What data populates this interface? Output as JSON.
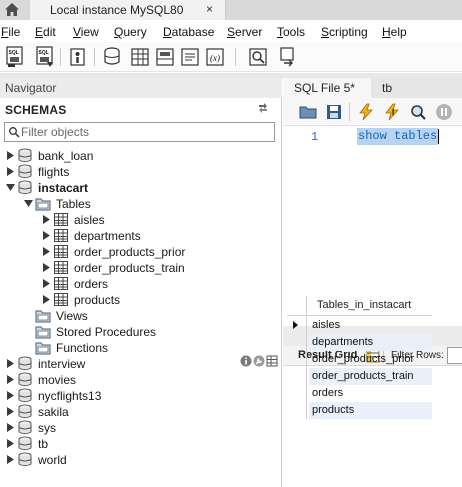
{
  "connection_tab": {
    "label": "Local instance MySQL80",
    "close": "×"
  },
  "menu": [
    {
      "label": "File",
      "acc": "F",
      "rest": "ile"
    },
    {
      "label": "Edit",
      "acc": "E",
      "rest": "dit"
    },
    {
      "label": "View",
      "acc": "V",
      "rest": "iew"
    },
    {
      "label": "Query",
      "acc": "Q",
      "rest": "uery"
    },
    {
      "label": "Database",
      "acc": "D",
      "rest": "atabase"
    },
    {
      "label": "Server",
      "acc": "S",
      "rest": "erver"
    },
    {
      "label": "Tools",
      "acc": "T",
      "rest": "ools"
    },
    {
      "label": "Scripting",
      "acc": "S",
      "rest": "cripting"
    },
    {
      "label": "Help",
      "acc": "H",
      "rest": "elp"
    }
  ],
  "navigator": {
    "header": "Navigator",
    "schemas_title": "SCHEMAS",
    "filter_placeholder": "Filter objects",
    "tree": [
      {
        "label": "bank_loan",
        "type": "schema",
        "expanded": false,
        "bold": false
      },
      {
        "label": "flights",
        "type": "schema",
        "expanded": false,
        "bold": false
      },
      {
        "label": "instacart",
        "type": "schema",
        "expanded": true,
        "bold": true
      },
      {
        "label": "Tables",
        "type": "folder",
        "expanded": true,
        "bold": false
      },
      {
        "label": "aisles",
        "type": "table",
        "expanded": false,
        "bold": false
      },
      {
        "label": "departments",
        "type": "table",
        "expanded": false,
        "bold": false
      },
      {
        "label": "order_products_prior",
        "type": "table",
        "expanded": false,
        "bold": false
      },
      {
        "label": "order_products_train",
        "type": "table",
        "expanded": false,
        "bold": false
      },
      {
        "label": "orders",
        "type": "table",
        "expanded": false,
        "bold": false
      },
      {
        "label": "products",
        "type": "table",
        "expanded": false,
        "bold": false
      },
      {
        "label": "Views",
        "type": "folder-leaf",
        "expanded": false,
        "bold": false
      },
      {
        "label": "Stored Procedures",
        "type": "folder-leaf",
        "expanded": false,
        "bold": false
      },
      {
        "label": "Functions",
        "type": "folder-leaf",
        "expanded": false,
        "bold": false
      },
      {
        "label": "interview",
        "type": "schema",
        "expanded": false,
        "bold": false
      },
      {
        "label": "movies",
        "type": "schema",
        "expanded": false,
        "bold": false
      },
      {
        "label": "nycflights13",
        "type": "schema",
        "expanded": false,
        "bold": false
      },
      {
        "label": "sakila",
        "type": "schema",
        "expanded": false,
        "bold": false
      },
      {
        "label": "sys",
        "type": "schema",
        "expanded": false,
        "bold": false
      },
      {
        "label": "tb",
        "type": "schema",
        "expanded": false,
        "bold": false
      },
      {
        "label": "world",
        "type": "schema",
        "expanded": false,
        "bold": false
      }
    ]
  },
  "editor": {
    "tabs": [
      {
        "label": "SQL File 5*",
        "active": true
      },
      {
        "label": "tb",
        "active": false
      }
    ],
    "line_number": "1",
    "code": "show tables"
  },
  "results": {
    "result_grid_label": "Result Grid",
    "filter_rows_label": "Filter Rows:",
    "column_header": "Tables_in_instacart",
    "rows": [
      "aisles",
      "departments",
      "order_products_prior",
      "order_products_train",
      "orders",
      "products"
    ]
  },
  "colors": {
    "selection": "#b7d3ef",
    "keyword": "#1565b8",
    "row_alt": "#e9f0fa"
  }
}
